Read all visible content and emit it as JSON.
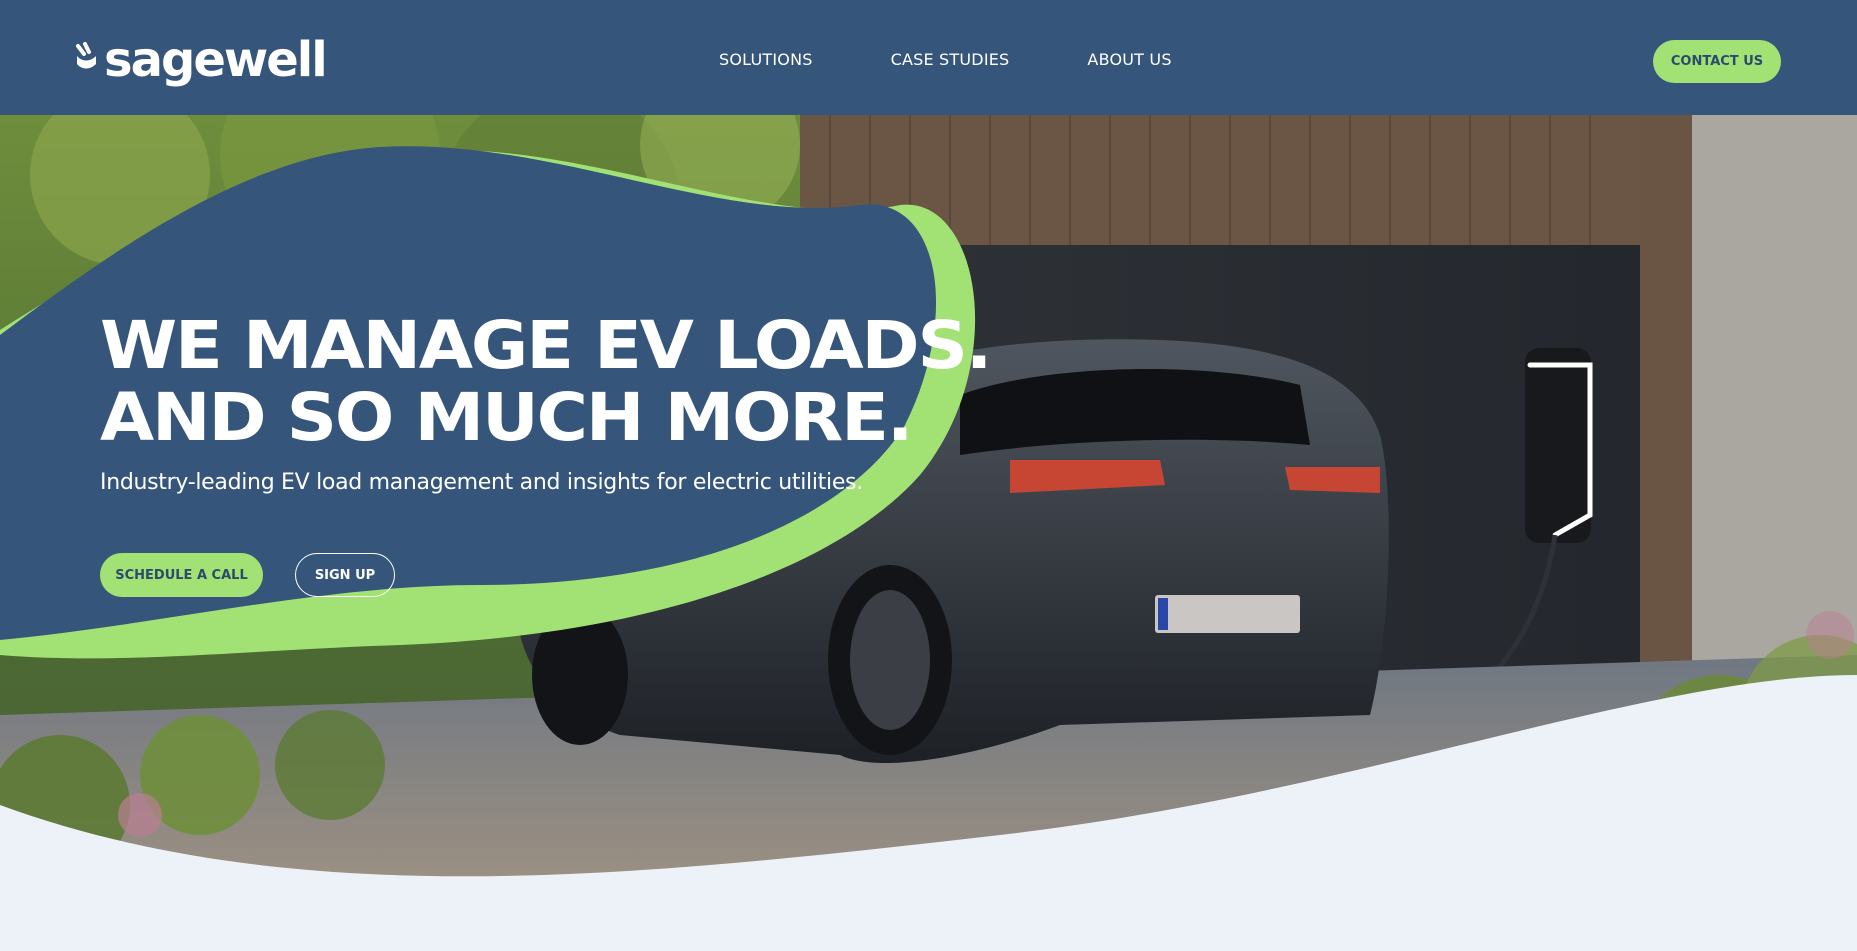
{
  "header": {
    "logo_text": "sagewell",
    "nav": [
      {
        "label": "SOLUTIONS"
      },
      {
        "label": "CASE STUDIES"
      },
      {
        "label": "ABOUT US"
      }
    ],
    "contact_label": "CONTACT US"
  },
  "hero": {
    "headline_line1": "WE MANAGE EV LOADS.",
    "headline_line2": "AND SO MUCH MORE.",
    "subhead": "Industry-leading EV load management and insights for electric utilities.",
    "primary_cta": "SCHEDULE A CALL",
    "secondary_cta": "SIGN UP"
  },
  "colors": {
    "navy": "#36557b",
    "accent_green": "#a2e274",
    "page_bg": "#edf2f9"
  }
}
